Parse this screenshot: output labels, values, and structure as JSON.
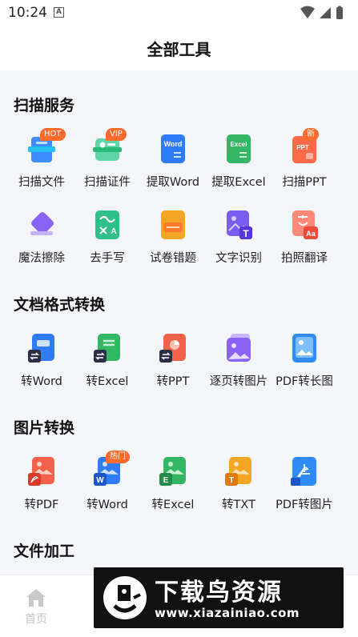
{
  "status_bar": {
    "time": "10:24",
    "notification_glyph": "A"
  },
  "header": {
    "title": "全部工具"
  },
  "sections": [
    {
      "title": "扫描服务",
      "tools": [
        {
          "label": "扫描文件",
          "icon": "scan-file-icon",
          "badge": "HOT"
        },
        {
          "label": "扫描证件",
          "icon": "scan-id-icon",
          "badge": "VIP"
        },
        {
          "label": "提取Word",
          "icon": "word-icon",
          "icon_text": "Word"
        },
        {
          "label": "提取Excel",
          "icon": "excel-icon",
          "icon_text": "Excel"
        },
        {
          "label": "扫描PPT",
          "icon": "ppt-icon",
          "badge": "新",
          "icon_text": "PPT"
        },
        {
          "label": "魔法擦除",
          "icon": "eraser-icon"
        },
        {
          "label": "去手写",
          "icon": "remove-handwriting-icon"
        },
        {
          "label": "试卷错题",
          "icon": "exam-icon"
        },
        {
          "label": "文字识别",
          "icon": "text-recognition-icon"
        },
        {
          "label": "拍照翻译",
          "icon": "photo-translate-icon",
          "icon_text": "Aa"
        }
      ]
    },
    {
      "title": "文档格式转换",
      "tools": [
        {
          "label": "转Word",
          "icon": "convert-word-icon"
        },
        {
          "label": "转Excel",
          "icon": "convert-excel-icon"
        },
        {
          "label": "转PPT",
          "icon": "convert-ppt-icon"
        },
        {
          "label": "逐页转图片",
          "icon": "page-to-image-icon"
        },
        {
          "label": "PDF转长图",
          "icon": "pdf-to-long-image-icon"
        }
      ]
    },
    {
      "title": "图片转换",
      "tools": [
        {
          "label": "转PDF",
          "icon": "image-to-pdf-icon"
        },
        {
          "label": "转Word",
          "icon": "image-to-word-icon",
          "badge": "热门",
          "icon_text": "W"
        },
        {
          "label": "转Excel",
          "icon": "image-to-excel-icon",
          "icon_text": "E"
        },
        {
          "label": "转TXT",
          "icon": "image-to-txt-icon",
          "icon_text": "T"
        },
        {
          "label": "PDF转图片",
          "icon": "pdf-to-image-icon"
        }
      ]
    },
    {
      "title": "文件加工",
      "tools": []
    }
  ],
  "tabbar": {
    "home_label": "首页"
  },
  "watermark": {
    "main": "下载鸟资源",
    "sub": "www.xiazainiao.com"
  },
  "colors": {
    "accent_orange": "#ff6b2c",
    "blue": "#2f7cf6",
    "green": "#34b765",
    "red": "#f2624a",
    "purple": "#7b5cf0",
    "yellow": "#f5a524"
  }
}
